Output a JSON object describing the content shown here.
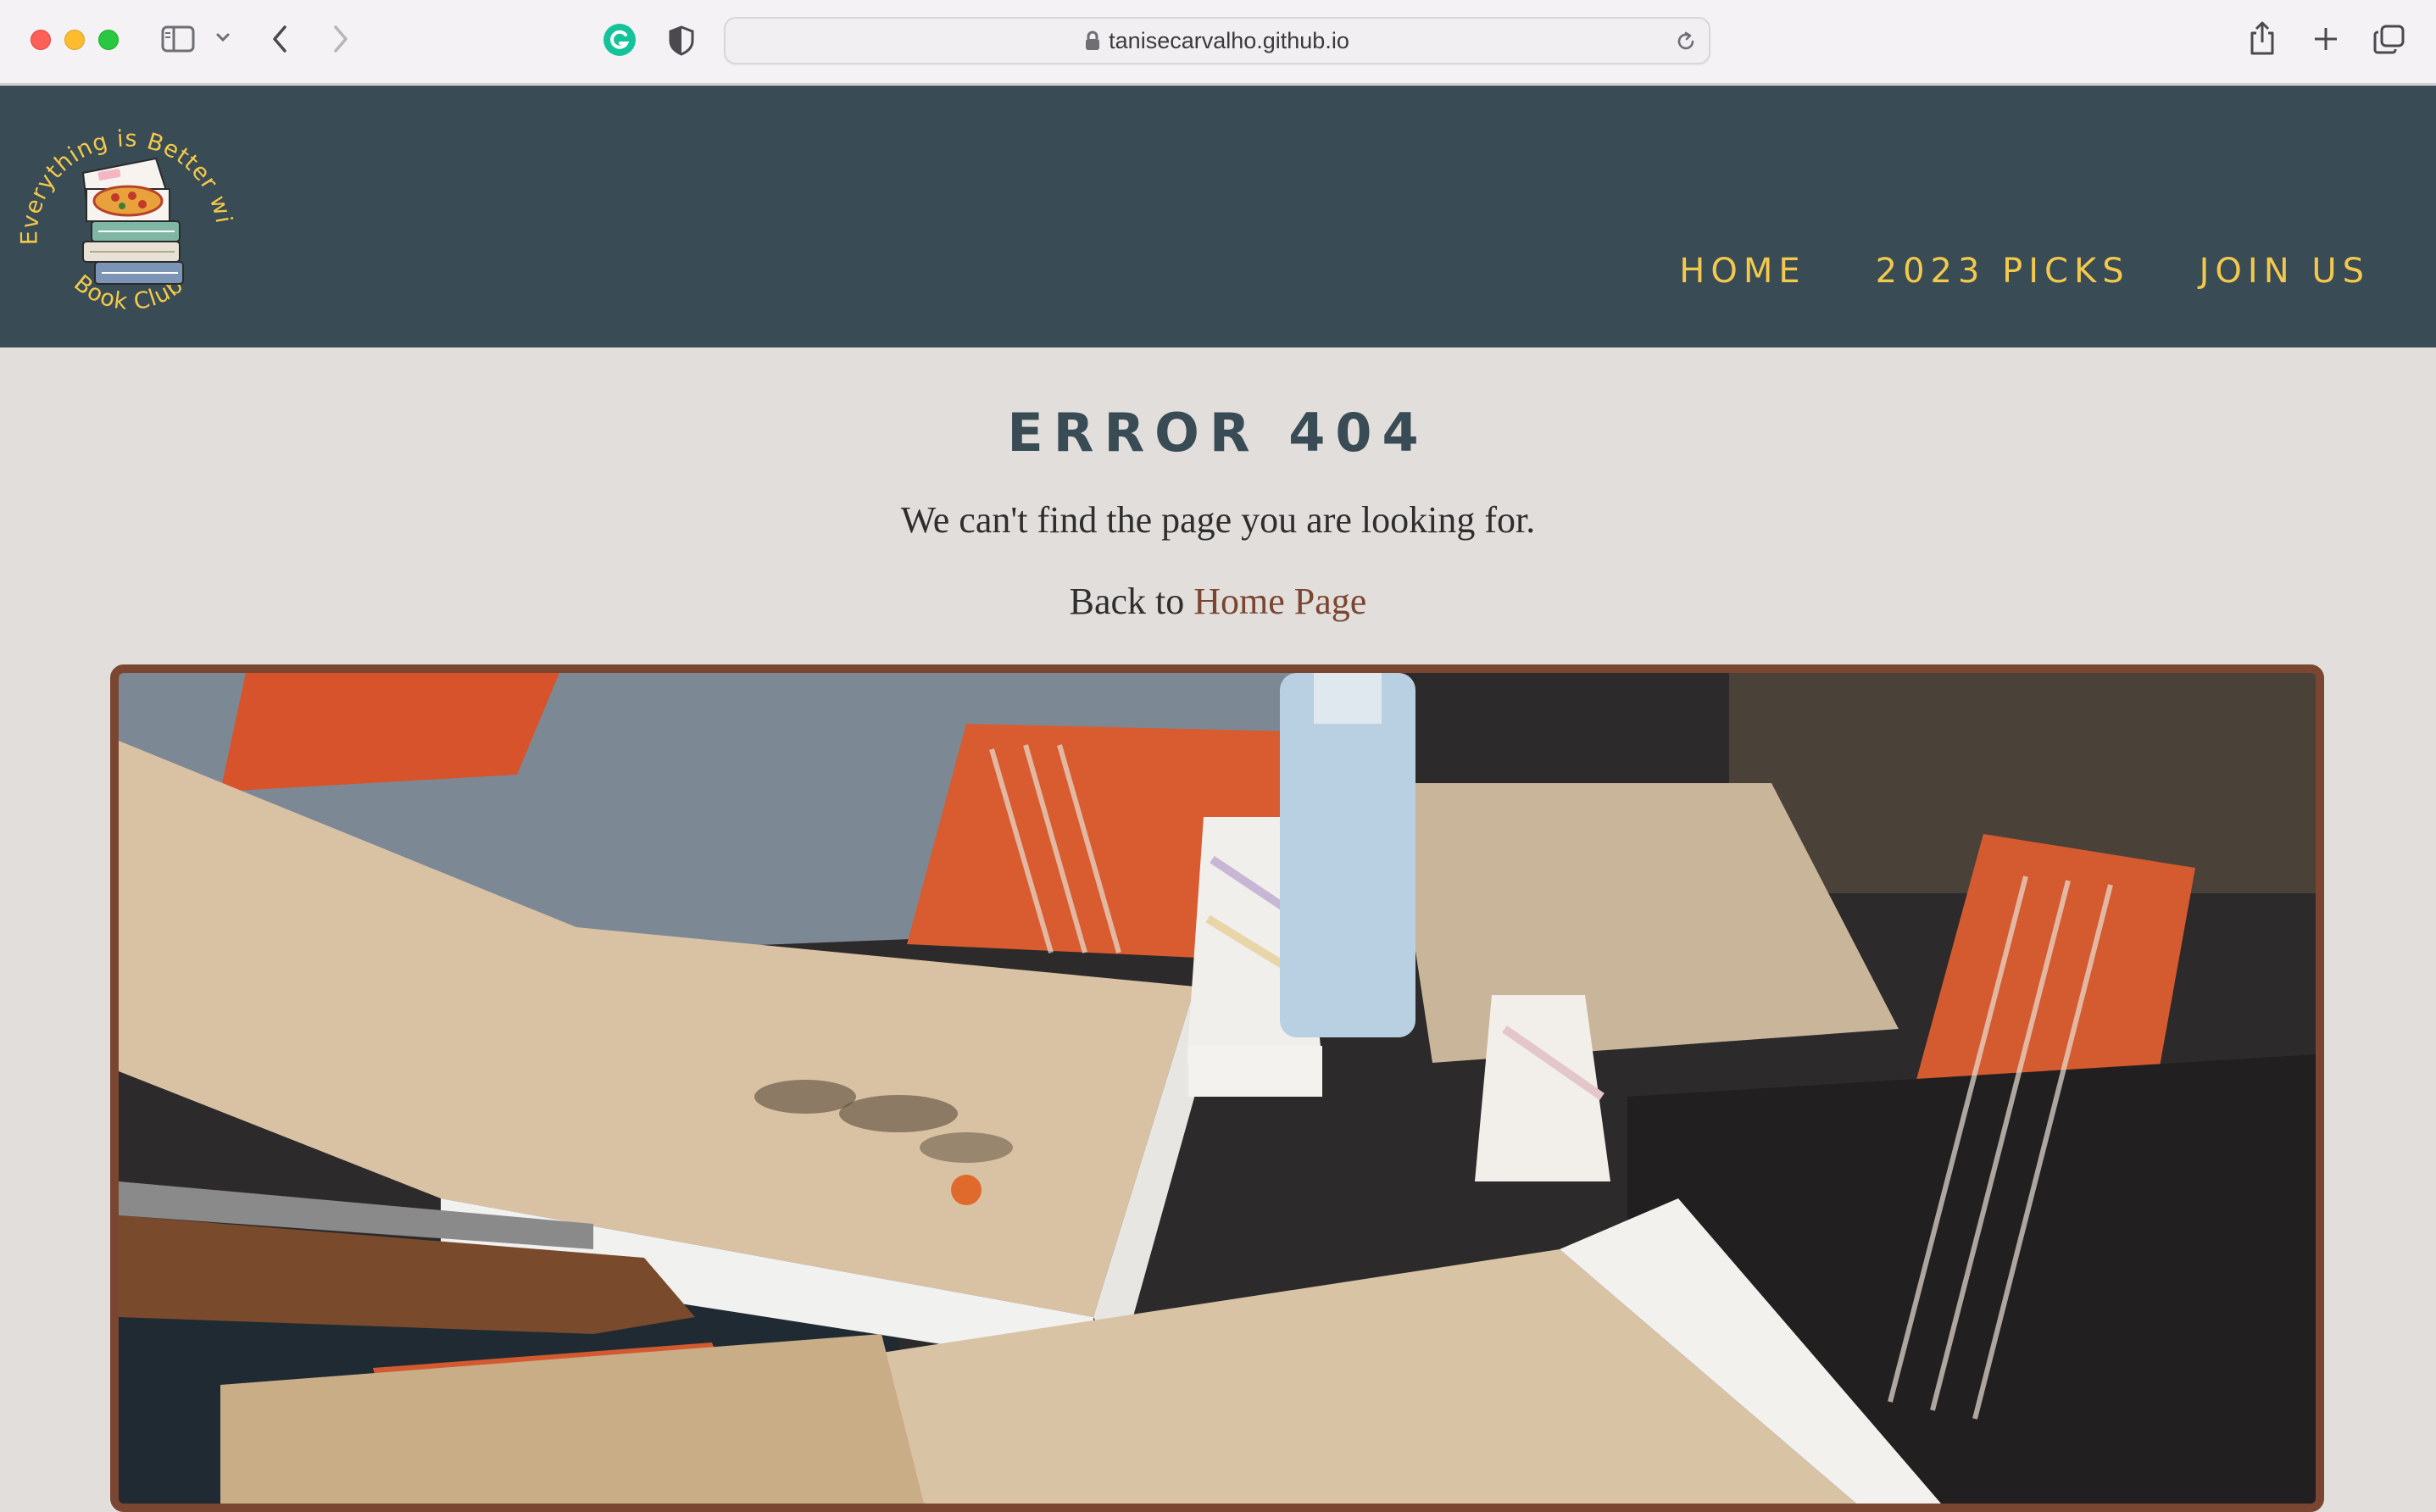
{
  "browser": {
    "url": "tanisecarvalho.github.io",
    "icons": [
      "sidebar-icon",
      "chevron-down-icon",
      "back-icon",
      "forward-icon",
      "grammarly-icon",
      "shield-icon",
      "lock-icon",
      "reload-icon",
      "share-icon",
      "new-tab-icon",
      "tabs-overview-icon"
    ]
  },
  "header": {
    "logo_text_top": "Everything is Better with Pizza",
    "logo_text_bottom": "Book Club",
    "nav": [
      {
        "label": "HOME"
      },
      {
        "label": "2023 PICKS"
      },
      {
        "label": "JOIN US"
      }
    ]
  },
  "main": {
    "title": "ERROR 404",
    "message": "We can't find the page you are looking for.",
    "back_prefix": "Back to ",
    "back_link": "Home Page"
  },
  "colors": {
    "header_bg": "#394b55",
    "nav_text": "#f2c94c",
    "page_bg": "#e2dedb",
    "accent_brown": "#7a4632"
  }
}
